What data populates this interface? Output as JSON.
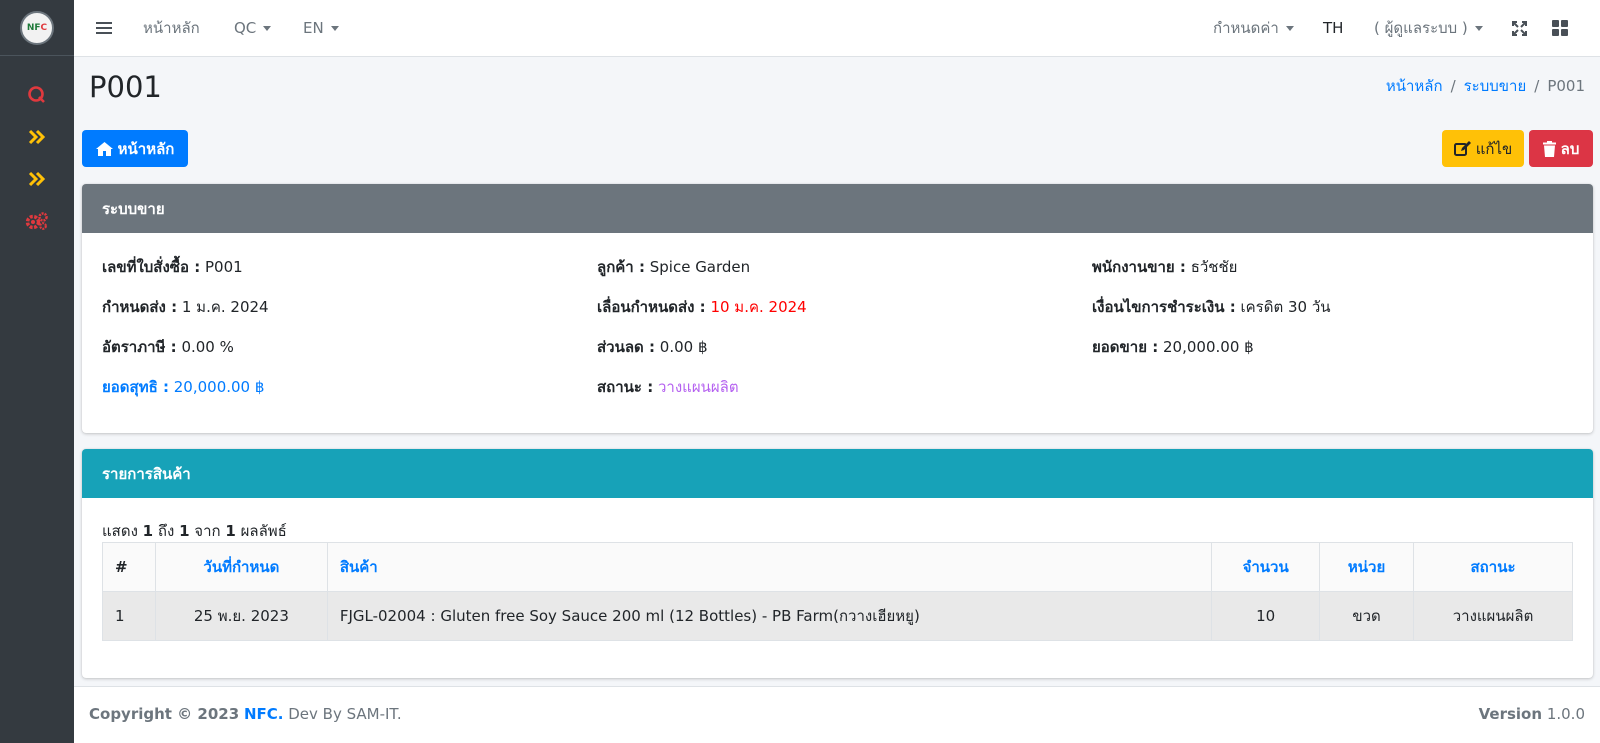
{
  "sidebar": {
    "logo_text_1": "NF",
    "logo_text_2": "C",
    "icons": [
      {
        "name": "qc-icon",
        "color": "#e0393e"
      },
      {
        "name": "double-chevron-right-icon",
        "color": "#ffc107"
      },
      {
        "name": "double-chevron-right-icon",
        "color": "#ffc107"
      },
      {
        "name": "gears-icon",
        "color": "#e0393e"
      }
    ]
  },
  "navbar": {
    "menu_icon": "hamburger-icon",
    "home": "หน้าหลัก",
    "qc": "QC",
    "lang": "EN",
    "settings": "กำหนดค่า",
    "th": "TH",
    "user": "( ผู้ดูแลระบบ )",
    "fullscreen_icon": "expand-icon",
    "apps_icon": "grid-icon"
  },
  "header": {
    "title": "P001",
    "breadcrumb": [
      "หน้าหลัก",
      "ระบบขาย",
      "P001"
    ]
  },
  "actions": {
    "home": "หน้าหลัก",
    "edit": "แก้ไข",
    "delete": "ลบ"
  },
  "details": {
    "heading": "ระบบขาย",
    "po_label": "เลขที่ใบสั่งซื้อ :",
    "po_value": "P001",
    "customer_label": "ลูกค้า :",
    "customer_value": "Spice Garden",
    "salesperson_label": "พนักงานขาย :",
    "salesperson_value": "ธวัชชัย",
    "due_label": "กำหนดส่ง :",
    "due_value": "1 ม.ค. 2024",
    "postponed_label": "เลื่อนกำหนดส่ง :",
    "postponed_value": "10 ม.ค. 2024",
    "payment_label": "เงื่อนไขการชำระเงิน :",
    "payment_value": "เครดิต 30 วัน",
    "tax_label": "อัตราภาษี :",
    "tax_value": "0.00 %",
    "discount_label": "ส่วนลด :",
    "discount_value": "0.00 ฿",
    "sales_label": "ยอดขาย :",
    "sales_value": "20,000.00 ฿",
    "net_label": "ยอดสุทธิ :",
    "net_value": "20,000.00 ฿",
    "status_label": "สถานะ :",
    "status_value": "วางแผนผลิต"
  },
  "items": {
    "heading": "รายการสินค้า",
    "result_prefix": "แสดง",
    "result_from": "1",
    "result_to_word": "ถึง",
    "result_to": "1",
    "result_of_word": "จาก",
    "result_total": "1",
    "result_suffix": "ผลลัพธ์",
    "columns": [
      "#",
      "วันที่กำหนด",
      "สินค้า",
      "จำนวน",
      "หน่วย",
      "สถานะ"
    ],
    "rows": [
      {
        "no": "1",
        "date": "25 พ.ย. 2023",
        "product": "FJGL-02004 : Gluten free Soy Sauce 200 ml (12 Bottles) - PB Farm(กวางเฮียหยู)",
        "qty": "10",
        "unit": "ขวด",
        "status": "วางแผนผลิต"
      }
    ]
  },
  "footer": {
    "copyright": "Copyright © 2023",
    "brand": "NFC.",
    "dev": "Dev By SAM-IT.",
    "version_label": "Version",
    "version_value": "1.0.0"
  }
}
